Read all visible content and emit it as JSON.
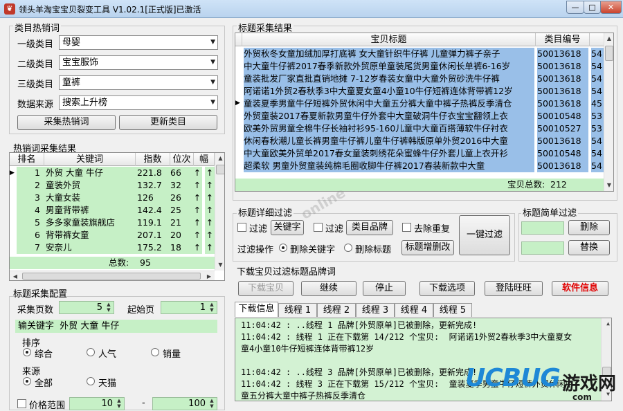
{
  "window": {
    "title": "领头羊淘宝宝贝裂变工具 V1.02.1[正式版]已激活",
    "min": "—",
    "max": "□",
    "close": "✕"
  },
  "category": {
    "title": "类目热销词",
    "level1_label": "一级类目",
    "level1_value": "母婴",
    "level2_label": "二级类目",
    "level2_value": "宝宝服饰",
    "level3_label": "三级类目",
    "level3_value": "童裤",
    "source_label": "数据来源",
    "source_value": "搜索上升榜",
    "collect_btn": "采集热销词",
    "update_btn": "更新类目"
  },
  "hotwords": {
    "title": "热销词采集结果",
    "headers": [
      "排名",
      "关键词",
      "指数",
      "位次",
      "幅"
    ],
    "rows": [
      {
        "rank": "1",
        "kw": "外贸 大童 牛仔",
        "idx": "221.8",
        "pos": "66",
        "a": "↑",
        "b": "↑"
      },
      {
        "rank": "2",
        "kw": "童装外贸",
        "idx": "132.7",
        "pos": "32",
        "a": "↑",
        "b": "↑"
      },
      {
        "rank": "3",
        "kw": "大童女装",
        "idx": "126",
        "pos": "26",
        "a": "↑",
        "b": "↑"
      },
      {
        "rank": "4",
        "kw": "男童背带裤",
        "idx": "142.4",
        "pos": "25",
        "a": "↑",
        "b": "↑"
      },
      {
        "rank": "5",
        "kw": "多多家童装旗舰店",
        "idx": "119.1",
        "pos": "21",
        "a": "↑",
        "b": "↑"
      },
      {
        "rank": "6",
        "kw": "背带裤女童",
        "idx": "207.1",
        "pos": "20",
        "a": "↑",
        "b": "↑"
      },
      {
        "rank": "7",
        "kw": "安奈儿",
        "idx": "175.2",
        "pos": "18",
        "a": "↑",
        "b": "↑"
      }
    ],
    "total_label": "总数:",
    "total": "95"
  },
  "config": {
    "title": "标题采集配置",
    "pages_label": "采集页数",
    "pages": "5",
    "start_label": "起始页",
    "start": "1",
    "keyword_label": "输关键字",
    "keyword": "外贸 大童 牛仔",
    "sort_label": "排序",
    "sort_opts": [
      "综合",
      "人气",
      "销量"
    ],
    "source_label": "来源",
    "source_opts": [
      "全部",
      "天猫"
    ],
    "price_label": "价格范围",
    "price_min": "10",
    "price_dash": "-",
    "price_max": "100"
  },
  "results": {
    "title": "标题采集结果",
    "headers": [
      "宝贝标题",
      "类目编号"
    ],
    "rows": [
      {
        "title": "外贸秋冬女童加绒加厚打底裤 女大童针织牛仔裤 儿童弹力裤子亲子",
        "cat": "50013618",
        "x": "54"
      },
      {
        "title": "中大童牛仔裤2017春季新款外贸原单童装尾货男童休闲长单裤6-16岁",
        "cat": "50013618",
        "x": "54"
      },
      {
        "title": "童装批发厂家直批直销地摊 7-12岁春装女童中大童外贸砂洗牛仔裤",
        "cat": "50013618",
        "x": "54"
      },
      {
        "title": "阿诺诺1外贸2春秋季3中大童夏女童4小童10牛仔短裤连体背带裤12岁",
        "cat": "50013618",
        "x": "54"
      },
      {
        "title": "童装夏季男童牛仔短裤外贸休闲中大童五分裤大童中裤子热裤反季清仓",
        "cat": "50013618",
        "x": "45"
      },
      {
        "title": "外贸童装2017春夏新款男童牛仔外套中大童破洞牛仔衣宝宝翻领上衣",
        "cat": "50010548",
        "x": "53"
      },
      {
        "title": "欧美外贸男童全棉牛仔长袖衬衫95-160儿童中大童百搭薄软牛仔衬衣",
        "cat": "50010527",
        "x": "53"
      },
      {
        "title": "休闲春秋潮儿童长裤男童牛仔裤儿童牛仔裤韩版原单外贸2016中大童",
        "cat": "50013618",
        "x": "54"
      },
      {
        "title": "中大童欧美外贸单2017春女童装刺绣花朵蜜蜂牛仔外套儿童上衣开衫",
        "cat": "50010548",
        "x": "54"
      },
      {
        "title": "超柔软 男童外贸童装纯棉毛圈收脚牛仔裤2017春装新款中大童",
        "cat": "50013618",
        "x": "54"
      }
    ],
    "total_label": "宝贝总数:",
    "total": "212"
  },
  "filter": {
    "title": "标题详细过滤",
    "filter_label": "过滤",
    "keyword_btn": "关键字",
    "filter2_label": "过滤",
    "brand_btn": "类目品牌",
    "dedupe_label": "去除重复",
    "onekey_btn": "一键过滤",
    "op_label": "过滤操作",
    "op_delkw": "删除关键字",
    "op_deltitle": "删除标题",
    "addrem_btn": "标题增删改"
  },
  "simple": {
    "title": "标题简单过滤",
    "delete_btn": "删除",
    "replace_btn": "替换"
  },
  "download": {
    "title": "下载宝贝过滤标题品牌词",
    "btns": [
      "下载宝贝",
      "继续",
      "停止",
      "下载选项",
      "登陆旺旺",
      "软件信息"
    ],
    "tabs": [
      "下载信息",
      "线程 1",
      "线程 2",
      "线程 3",
      "线程 4",
      "线程 5"
    ],
    "log": [
      "11:04:42 : ..线程 1 品牌[外贸原单]已被删除，更新完成!",
      "11:04:42 : 线程 1 正在下载第 14/212 个宝贝:  阿诺诺1外贸2春秋季3中大童夏女",
      "童4小童10牛仔短裤连体背带裤12岁",
      "",
      "11:04:42 : ..线程 3 品牌[外贸原单]已被删除，更新完成!",
      "11:04:42 : 线程 3 正在下载第 15/212 个宝贝:  童装夏季男童牛仔短裤外贸休闲中",
      "童五分裤大童中裤子热裤反季清仓"
    ]
  },
  "watermarks": {
    "ucbug": "UCBUG",
    "ucbug_cn": "游戏网",
    "site": "com",
    "online": "online"
  }
}
